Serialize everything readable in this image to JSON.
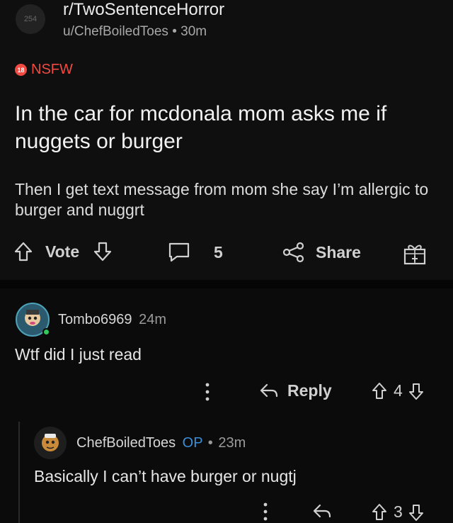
{
  "post": {
    "subreddit": "r/TwoSentenceHorror",
    "avatar_text": "254",
    "author": "u/ChefBoiledToes",
    "separator": "•",
    "time": "30m",
    "nsfw_label": "NSFW",
    "nsfw_badge": "18",
    "title": "In the car for mcdonala mom asks me if nuggets or burger",
    "body": "Then I get text message from mom she say I’m allergic to burger and nuggrt",
    "vote_label": "Vote",
    "comment_count": "5",
    "share_label": "Share"
  },
  "comments": [
    {
      "author": "Tombo6969",
      "time": "24m",
      "text": "Wtf did I just read",
      "reply_label": "Reply",
      "score": "4"
    },
    {
      "author": "ChefBoiledToes",
      "op_label": "OP",
      "separator": "•",
      "time": "23m",
      "text": "Basically I can’t have burger or nugtj",
      "score": "3"
    }
  ],
  "colors": {
    "nsfw": "#ef4b43",
    "op": "#3b8fd9",
    "background": "#0b0b0b"
  }
}
